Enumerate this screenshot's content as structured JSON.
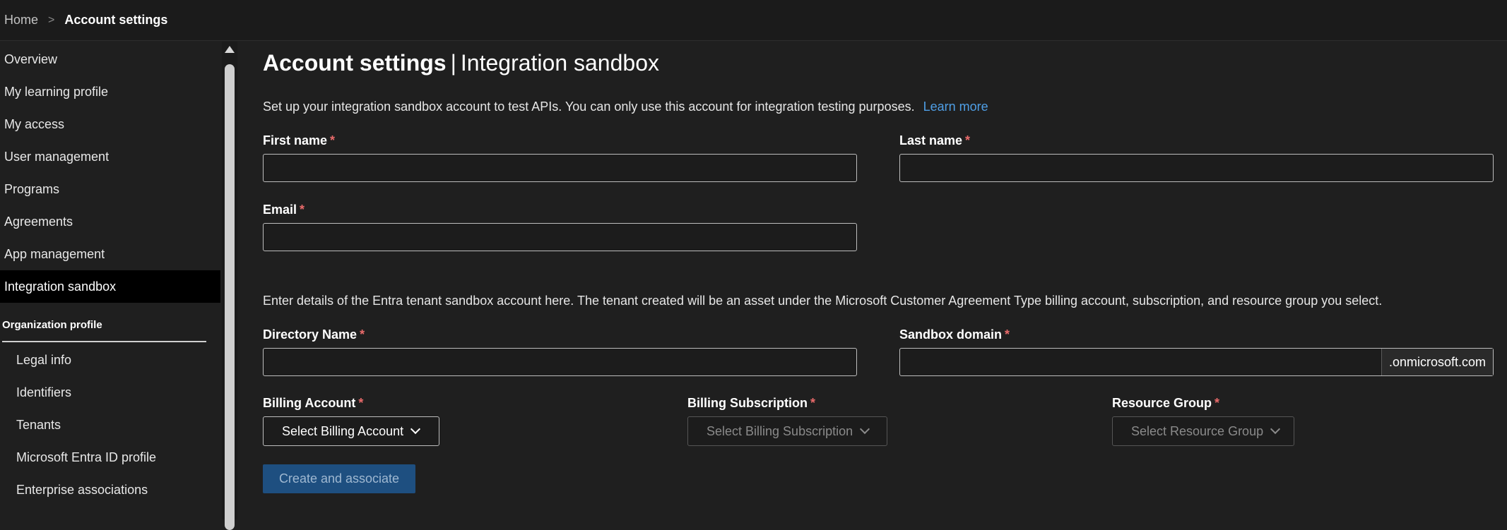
{
  "breadcrumb": {
    "home": "Home",
    "separator": ">",
    "current": "Account settings"
  },
  "sidebar": {
    "items": [
      {
        "label": "Overview"
      },
      {
        "label": "My learning profile"
      },
      {
        "label": "My access"
      },
      {
        "label": "User management"
      },
      {
        "label": "Programs"
      },
      {
        "label": "Agreements"
      },
      {
        "label": "App management"
      },
      {
        "label": "Integration sandbox",
        "active": true
      }
    ],
    "section_title": "Organization profile",
    "sub_items": [
      {
        "label": "Legal info"
      },
      {
        "label": "Identifiers"
      },
      {
        "label": "Tenants"
      },
      {
        "label": "Microsoft Entra ID profile"
      },
      {
        "label": "Enterprise associations"
      }
    ]
  },
  "main": {
    "title_main": "Account settings",
    "title_sep": "|",
    "title_sub": "Integration sandbox",
    "intro": "Set up your integration sandbox account to test APIs. You can only use this account for integration testing purposes.",
    "learn_more": "Learn more",
    "first_name_label": "First name",
    "last_name_label": "Last name",
    "email_label": "Email",
    "required_mark": "*",
    "tenant_intro": "Enter details of the Entra tenant sandbox account here. The tenant created will be an asset under the Microsoft Customer Agreement Type billing account, subscription, and resource group you select.",
    "directory_name_label": "Directory Name",
    "sandbox_domain_label": "Sandbox domain",
    "domain_suffix": ".onmicrosoft.com",
    "billing_account_label": "Billing Account",
    "billing_account_select": "Select Billing Account",
    "billing_subscription_label": "Billing Subscription",
    "billing_subscription_select": "Select Billing Subscription",
    "resource_group_label": "Resource Group",
    "resource_group_select": "Select Resource Group",
    "create_button": "Create and associate"
  },
  "colors": {
    "background": "#1f1f1f",
    "active_nav": "#000000",
    "link": "#4f9fe6",
    "required": "#e86a6a",
    "primary_button": "#1e4f80"
  }
}
